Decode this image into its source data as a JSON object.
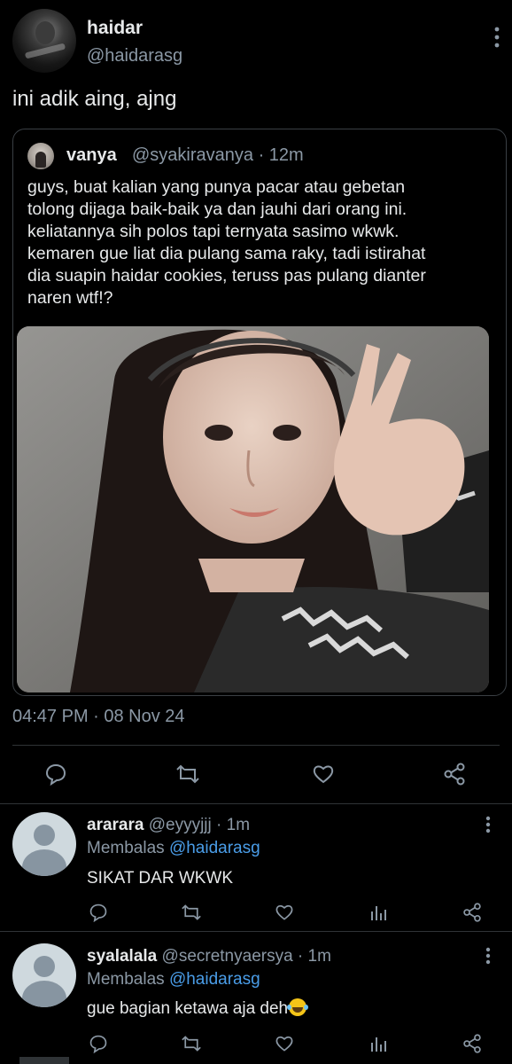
{
  "main_tweet": {
    "name": "haidar",
    "handle": "@haidarasg",
    "text": "ini adik aing, ajng",
    "timestamp": "04:47 PM · 08 Nov 24",
    "quote": {
      "name": "vanya",
      "meta": "@syakiravanya · 12m",
      "body": "guys, buat kalian yang punya pacar atau gebetan\ntolong dijaga baik-baik ya dan jauhi dari orang ini.\nkeliatannya sih polos tapi ternyata sasimo wkwk.\nkemaren gue liat dia pulang sama raky, tadi istirahat\ndia suapin haidar cookies, teruss pas pulang dianter\nnaren wtf!?"
    }
  },
  "replies": [
    {
      "name": "ararara",
      "meta": "@eyyyjjj · 1m",
      "replying_prefix": "Membalas",
      "replying_handle": "@haidarasg",
      "text": "SIKAT DAR WKWK"
    },
    {
      "name": "syalalala",
      "meta": "@secretnyaersya · 1m",
      "replying_prefix": "Membalas",
      "replying_handle": "@haidarasg",
      "text": "gue bagian ketawa aja deh"
    }
  ],
  "icons": [
    "more-icon",
    "reply-icon",
    "retweet-icon",
    "like-icon",
    "share-icon",
    "stats-icon"
  ],
  "colors": {
    "background": "#000000",
    "text": "#e7e9ea",
    "muted": "#8b98a5",
    "link": "#4a9de8",
    "divider": "#2f3336"
  }
}
